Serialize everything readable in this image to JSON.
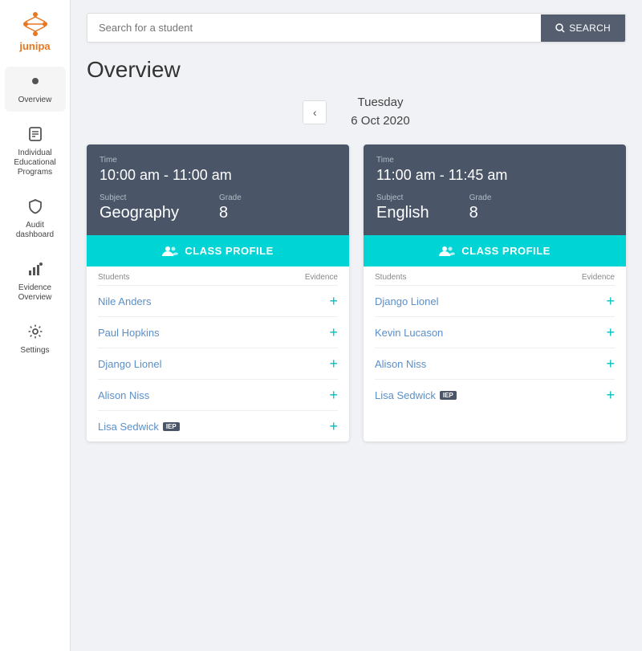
{
  "app": {
    "name": "junipa"
  },
  "sidebar": {
    "items": [
      {
        "id": "overview",
        "label": "Overview",
        "icon": "circle"
      },
      {
        "id": "iep",
        "label": "Individual Educational Programs",
        "icon": "iep"
      },
      {
        "id": "audit",
        "label": "Audit dashboard",
        "icon": "shield"
      },
      {
        "id": "evidence",
        "label": "Evidence Overview",
        "icon": "chart"
      },
      {
        "id": "settings",
        "label": "Settings",
        "icon": "gear"
      }
    ]
  },
  "search": {
    "placeholder": "Search for a student",
    "button_label": "SEARCH"
  },
  "page_title": "Overview",
  "date": {
    "day": "Tuesday",
    "date": "6 Oct 2020"
  },
  "sessions": [
    {
      "time_label": "Time",
      "time": "10:00 am - 11:00 am",
      "subject_label": "Subject",
      "subject": "Geography",
      "grade_label": "Grade",
      "grade": "8",
      "profile_button": "CLASS PROFILE",
      "students_label": "Students",
      "evidence_label": "Evidence",
      "students": [
        {
          "name": "Nile Anders",
          "iep": false
        },
        {
          "name": "Paul Hopkins",
          "iep": false
        },
        {
          "name": "Django Lionel",
          "iep": false
        },
        {
          "name": "Alison Niss",
          "iep": false
        },
        {
          "name": "Lisa Sedwick",
          "iep": true
        }
      ]
    },
    {
      "time_label": "Time",
      "time": "11:00 am - 11:45 am",
      "subject_label": "Subject",
      "subject": "English",
      "grade_label": "Grade",
      "grade": "8",
      "profile_button": "CLASS PROFILE",
      "students_label": "Students",
      "evidence_label": "Evidence",
      "students": [
        {
          "name": "Django Lionel",
          "iep": false
        },
        {
          "name": "Kevin Lucason",
          "iep": false
        },
        {
          "name": "Alison Niss",
          "iep": false
        },
        {
          "name": "Lisa Sedwick",
          "iep": true
        }
      ]
    }
  ]
}
